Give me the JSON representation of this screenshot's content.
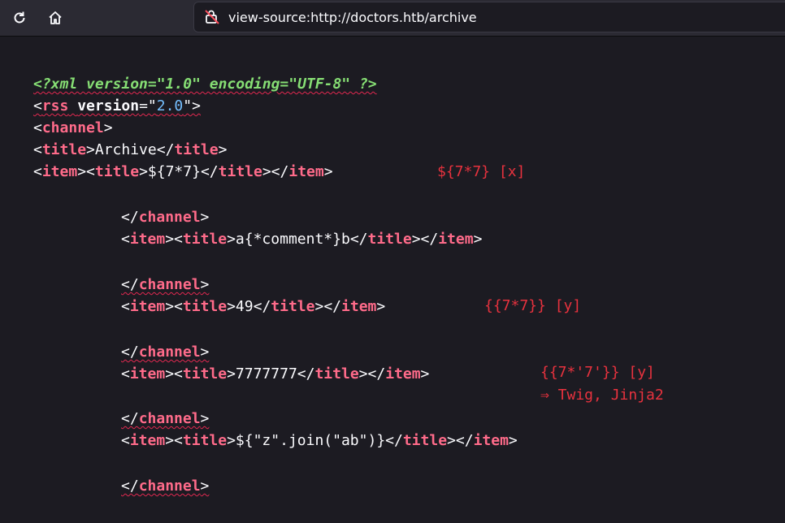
{
  "browser": {
    "url": "view-source:http://doctors.htb/archive",
    "icons": {
      "reload": "reload-icon",
      "home": "home-icon",
      "security": "insecure-lock-icon"
    }
  },
  "source": {
    "line1": {
      "pi": "<?xml version=\"1.0\" encoding=\"UTF-8\" ?>"
    },
    "line2": {
      "open": "<",
      "tag": "rss",
      "attr": "version",
      "eq": "=\"",
      "val": "2.0",
      "close": "\">"
    },
    "line3": {
      "open": "<",
      "tag": "channel",
      "close": ">"
    },
    "line4": {
      "open": "<",
      "tag": "title",
      "close": ">",
      "text": "Archive",
      "endopen": "</",
      "endtag": "title",
      "endclose": ">"
    },
    "line5": {
      "lt1": "<",
      "tag1": "item",
      "gt1": ">",
      "lt2": "<",
      "tag2": "title",
      "gt2": ">",
      "text": "${7*7}",
      "lt3": "</",
      "tag3": "title",
      "gt3": ">",
      "lt4": "</",
      "tag4": "item",
      "gt4": ">"
    },
    "line6": {
      "lt": "</",
      "tag": "channel",
      "gt": ">"
    },
    "line7": {
      "lt1": "<",
      "tag1": "item",
      "gt1": ">",
      "lt2": "<",
      "tag2": "title",
      "gt2": ">",
      "text": "a{*comment*}b",
      "lt3": "</",
      "tag3": "title",
      "gt3": ">",
      "lt4": "</",
      "tag4": "item",
      "gt4": ">"
    },
    "line8": {
      "lt": "</",
      "tag": "channel",
      "gt": ">"
    },
    "line9": {
      "lt1": "<",
      "tag1": "item",
      "gt1": ">",
      "lt2": "<",
      "tag2": "title",
      "gt2": ">",
      "text": "49",
      "lt3": "</",
      "tag3": "title",
      "gt3": ">",
      "lt4": "</",
      "tag4": "item",
      "gt4": ">"
    },
    "line10": {
      "lt": "</",
      "tag": "channel",
      "gt": ">"
    },
    "line11": {
      "lt1": "<",
      "tag1": "item",
      "gt1": ">",
      "lt2": "<",
      "tag2": "title",
      "gt2": ">",
      "text": "7777777",
      "lt3": "</",
      "tag3": "title",
      "gt3": ">",
      "lt4": "</",
      "tag4": "item",
      "gt4": ">"
    },
    "line12": {
      "lt": "</",
      "tag": "channel",
      "gt": ">"
    },
    "line13": {
      "lt1": "<",
      "tag1": "item",
      "gt1": ">",
      "lt2": "<",
      "tag2": "title",
      "gt2": ">",
      "text": "${\"z\".join(\"ab\")}",
      "lt3": "</",
      "tag3": "title",
      "gt3": ">",
      "lt4": "</",
      "tag4": "item",
      "gt4": ">"
    },
    "line14": {
      "lt": "</",
      "tag": "channel",
      "gt": ">"
    }
  },
  "annotations": {
    "a1": "${7*7} [x]",
    "a2": "{{7*7}} [y]",
    "a3": "{{7*'7'}} [y]",
    "a4": "⇒ Twig, Jinja2"
  },
  "colors": {
    "annotation": "#e8323e",
    "tag_name": "#ff6b8a",
    "attr_value": "#75bfff",
    "pi": "#86de74",
    "background": "#1c1b22"
  }
}
